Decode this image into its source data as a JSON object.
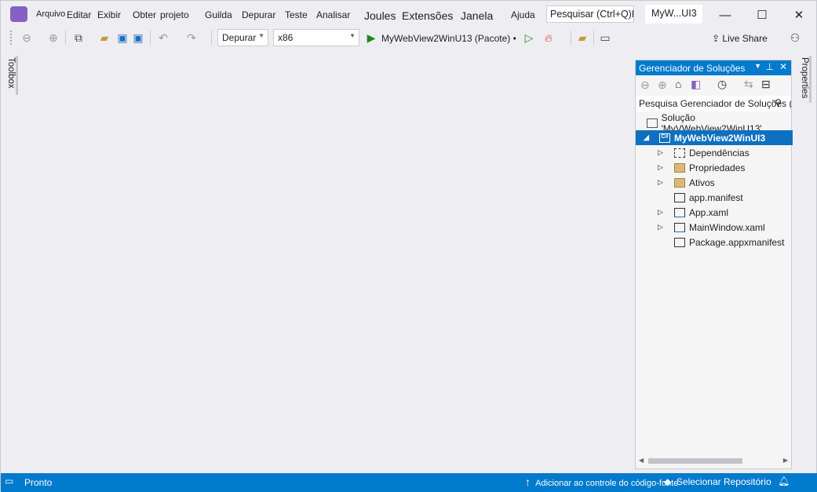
{
  "menu": [
    "Arquivo",
    "Editar",
    "Exibir",
    "Obter",
    "projeto",
    "Guilda",
    "Depurar",
    "Teste",
    "Analisar",
    "Joules",
    "Extensões",
    "Janela",
    "Ajuda"
  ],
  "search": {
    "placeholder": "Pesquisar (Ctrl+Q)P"
  },
  "window_title": "MyW...UI3",
  "toolbar": {
    "config": "Depurar",
    "platform": "x86",
    "run_target": "MyWebView2WinU13 (Pacote) •",
    "live_share": "Live Share"
  },
  "side": {
    "toolbox": "Toolbox",
    "properties": "Properties"
  },
  "solution_explorer": {
    "title": "Gerenciador de Soluções",
    "search_placeholder": "Pesquisa Gerenciador de Soluções (Ctrl*",
    "solution": "Solução 'MyVWebView2WinU13'",
    "project": "MyWebView2WinUI3",
    "items": [
      {
        "label": "Dependências",
        "icon": "dependencies-icon",
        "expandable": true
      },
      {
        "label": "Propriedades",
        "icon": "properties-folder-icon",
        "expandable": true
      },
      {
        "label": "Ativos",
        "icon": "folder-icon",
        "expandable": true
      },
      {
        "label": "app.manifest",
        "icon": "manifest-icon",
        "expandable": false
      },
      {
        "label": "App.xaml",
        "icon": "xaml-file-icon",
        "expandable": true
      },
      {
        "label": "MainWindow.xaml",
        "icon": "xaml-file-icon",
        "expandable": true
      },
      {
        "label": "Package.appxmanifest",
        "icon": "appxmanifest-icon",
        "expandable": false
      }
    ]
  },
  "status": {
    "ready": "Pronto",
    "source_control": "Adicionar ao controle do código-fonte",
    "repo": "Selecionar Repositório"
  },
  "colors": {
    "accent": "#007acc",
    "logo": "#8661c5",
    "background": "#eeeef2"
  }
}
